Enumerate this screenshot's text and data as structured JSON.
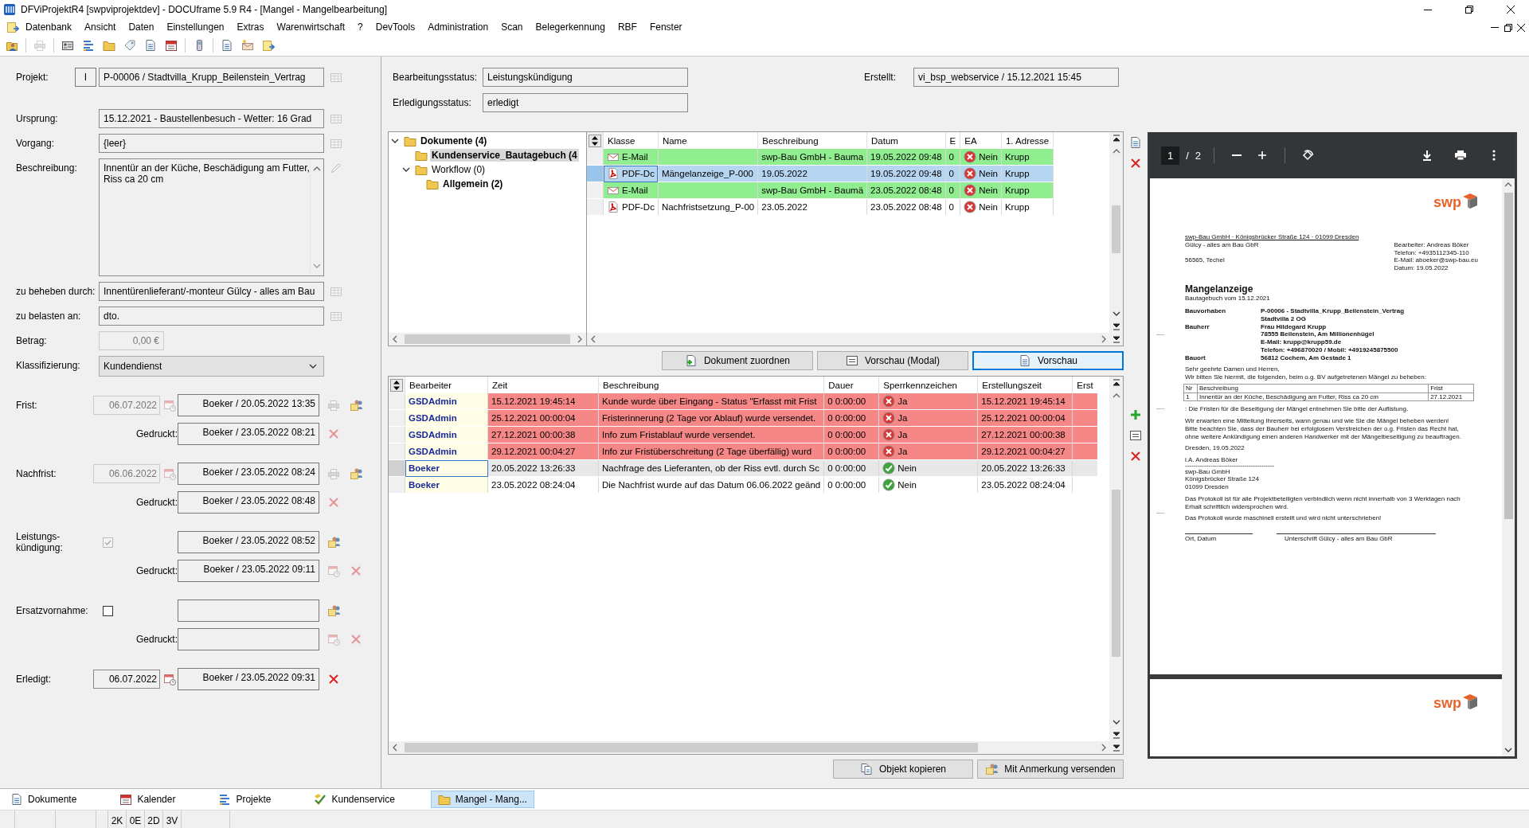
{
  "window": {
    "title": "DFViProjektR4 [swpviprojektdev] - DOCUframe 5.9 R4 - [Mangel - Mangelbearbeitung]"
  },
  "menu": [
    "Datenbank",
    "Ansicht",
    "Daten",
    "Einstellungen",
    "Extras",
    "Warenwirtschaft",
    "?",
    "DevTools",
    "Administration",
    "Scan",
    "Belegerkennung",
    "RBF",
    "Fenster"
  ],
  "form": [
    {
      "kind": "lookup",
      "label": "Projekt:",
      "button": "I",
      "value": "P-00006 / Stadtvilla_Krupp_Beilenstein_Vertrag"
    },
    {
      "kind": "lookup",
      "label": "Ursprung:",
      "value": "15.12.2021 - Baustellenbesuch - Wetter: 16 Grad"
    },
    {
      "kind": "lookup",
      "label": "Vorgang:",
      "value": "{leer}"
    },
    {
      "kind": "memo",
      "label": "Beschreibung:",
      "value": "Innentür an der Küche, Beschädigung am Futter, Riss ca 20 cm"
    },
    {
      "kind": "lookup",
      "label": "zu beheben durch:",
      "value": "Innentürenlieferant/-monteur Gülcy - alles am Bau"
    },
    {
      "kind": "lookup",
      "label": "zu belasten an:",
      "value": "dto."
    },
    {
      "kind": "amount",
      "label": "Betrag:",
      "value": "0,00 €",
      "disabled": true
    },
    {
      "kind": "dropdown",
      "label": "Klassifizierung:",
      "value": "Kundendienst"
    }
  ],
  "deadlines": [
    {
      "kind": "date",
      "label": "Frist:",
      "date": "06.07.2022",
      "date_disabled": true,
      "entry": "Boeker / 20.05.2022 13:35",
      "printed_label": "Gedruckt:",
      "printed": "Boeker / 23.05.2022 08:21"
    },
    {
      "kind": "date",
      "label": "Nachfrist:",
      "date": "06.06.2022",
      "date_disabled": true,
      "entry": "Boeker / 23.05.2022 08:24",
      "printed_label": "Gedruckt:",
      "printed": "Boeker / 23.05.2022 08:48"
    },
    {
      "kind": "check",
      "label": "Leistungs-\nkündigung:",
      "checked": true,
      "disabled": true,
      "entry": "Boeker / 23.05.2022 08:52",
      "printed_label": "Gedruckt:",
      "printed": "Boeker / 23.05.2022 09:11"
    },
    {
      "kind": "check",
      "label": "Ersatzvornahme:",
      "checked": false,
      "disabled": false,
      "printed_label": "Gedruckt:"
    },
    {
      "kind": "date",
      "label": "Erledigt:",
      "date": "06.07.2022",
      "date_disabled": false,
      "entry": "Boeker / 23.05.2022 09:31"
    }
  ],
  "status": {
    "fields": [
      {
        "label": "Bearbeitungsstatus:",
        "value": "Leistungskündigung"
      },
      {
        "label": "Erledigungsstatus:",
        "value": "erledigt"
      }
    ],
    "created": {
      "label": "Erstellt:",
      "value": "vi_bsp_webservice / 15.12.2021 15:45"
    }
  },
  "tree": [
    {
      "label": "Dokumente (4)",
      "bold": true,
      "expanded": true,
      "selected": false,
      "children": [
        {
          "label": "Kundenservice_Bautagebuch (4",
          "bold": true,
          "selected": true
        },
        {
          "label": "Workflow (0)",
          "bold": false,
          "expanded": true,
          "selected": false,
          "children": [
            {
              "label": "Allgemein (2)",
              "bold": true,
              "selected": false
            }
          ]
        }
      ]
    }
  ],
  "documents": {
    "columns": [
      "Klasse",
      "Name",
      "Beschreibung",
      "Datum",
      "E",
      "EA",
      "1. Adresse"
    ],
    "rows": [
      {
        "kind": "email",
        "klasse": "E-Mail",
        "beschreibung": "swp-Bau GmbH - Bauma",
        "datum": "19.05.2022 09:48",
        "e": "0",
        "ea": "Nein",
        "ea_ok": false,
        "adresse": "Krupp",
        "color": "#90ee90",
        "selected": false
      },
      {
        "kind": "pdf",
        "klasse": "PDF-Dc",
        "name": "Mängelanzeige_P-000",
        "beschreibung": "19.05.2022",
        "datum": "19.05.2022 09:48",
        "e": "0",
        "ea": "Nein",
        "ea_ok": false,
        "adresse": "Krupp",
        "color": "#b5d5f1",
        "selected": true
      },
      {
        "kind": "email",
        "klasse": "E-Mail",
        "beschreibung": "swp-Bau GmbH - Baumä",
        "datum": "23.05.2022 08:48",
        "e": "0",
        "ea": "Nein",
        "ea_ok": false,
        "adresse": "Krupp",
        "color": "#90ee90",
        "selected": false
      },
      {
        "kind": "pdf",
        "klasse": "PDF-Dc",
        "name": "Nachfristsetzung_P-00",
        "beschreibung": "23.05.2022",
        "datum": "23.05.2022 08:48",
        "e": "0",
        "ea": "Nein",
        "ea_ok": false,
        "adresse": "Krupp",
        "color": "#ffffff",
        "selected": false
      }
    ]
  },
  "doc_buttons": [
    {
      "label": "Dokument zuordnen",
      "selected": false
    },
    {
      "label": "Vorschau (Modal)",
      "selected": false
    },
    {
      "label": "Vorschau",
      "selected": true
    }
  ],
  "history": {
    "columns": [
      "Bearbeiter",
      "Zeit",
      "Beschreibung",
      "Dauer",
      "Sperrkennzeichen",
      "Erstellungszeit",
      "Erst"
    ],
    "rows": [
      {
        "bearbeiter": "GSDAdmin",
        "zeit": "15.12.2021 19:45:14",
        "beschreibung": "Kunde wurde über Eingang - Status \"Erfasst mit Frist",
        "dauer": "0 0:00:00",
        "sperre": "Ja",
        "sperre_ok": false,
        "erstellt": "15.12.2021 19:45:14",
        "color": "#f58787",
        "selected": false
      },
      {
        "bearbeiter": "GSDAdmin",
        "zeit": "25.12.2021 00:00:04",
        "beschreibung": "Fristerinnerung (2 Tage vor Ablauf) wurde versendet.",
        "dauer": "0 0:00:00",
        "sperre": "Ja",
        "sperre_ok": false,
        "erstellt": "25.12.2021 00:00:04",
        "color": "#f58787",
        "selected": false
      },
      {
        "bearbeiter": "GSDAdmin",
        "zeit": "27.12.2021 00:00:38",
        "beschreibung": "Info zum Fristablauf wurde versendet.",
        "dauer": "0 0:00:00",
        "sperre": "Ja",
        "sperre_ok": false,
        "erstellt": "27.12.2021 00:00:38",
        "color": "#f58787",
        "selected": false
      },
      {
        "bearbeiter": "GSDAdmin",
        "zeit": "29.12.2021 00:04:27",
        "beschreibung": "Info zur Fristüberschreitung (2 Tage überfällig) wurd",
        "dauer": "0 0:00:00",
        "sperre": "Ja",
        "sperre_ok": false,
        "erstellt": "29.12.2021 00:04:27",
        "color": "#f58787",
        "selected": false
      },
      {
        "bearbeiter": "Boeker",
        "zeit": "20.05.2022 13:26:33",
        "beschreibung": "Nachfrage des Lieferanten, ob der Riss evtl. durch Sc",
        "dauer": "0 0:00:00",
        "sperre": "Nein",
        "sperre_ok": true,
        "erstellt": "20.05.2022 13:26:33",
        "color": "#e8e8e8",
        "selected": true
      },
      {
        "bearbeiter": "Boeker",
        "zeit": "23.05.2022 08:24:04",
        "beschreibung": "Die Nachfrist wurde auf das Datum 06.06.2022 geänd",
        "dauer": "0 0:00:00",
        "sperre": "Nein",
        "sperre_ok": true,
        "erstellt": "23.05.2022 08:24:04",
        "color": "#ffffff",
        "selected": false
      }
    ]
  },
  "history_buttons": [
    "Objekt kopieren",
    "Mit Anmerkung versenden"
  ],
  "preview": {
    "page": "1",
    "separator": "/",
    "pages": "2",
    "document": {
      "logo": "swp",
      "sender_line": "swp-Bau GmbH · Königsbrücker Straße 124 · 01099 Dresden",
      "recipient": [
        "Gülcy - alles am Bau GbR",
        "56565, Techel"
      ],
      "contact": [
        "Bearbeiter: Andreas Böker",
        "Telefon: +4935112345-110",
        "E-Mail: aboeker@swp-bau.eu",
        "Datum: 19.05.2022"
      ],
      "title": "Mangelanzeige",
      "subtitle": "Bautagebuch vom 15.12.2021",
      "details": [
        {
          "label": "Bauvorhaben",
          "lines": [
            "P-00006 - Stadtvilla_Krupp_Beilenstein_Vertrag",
            "Stadtvilla 2 OG"
          ]
        },
        {
          "label": "Bauherr",
          "lines": [
            "Frau Hildegard Krupp",
            "78555 Beilenstein, Am Millionenhügel",
            "E-Mail: krupp@krupp59.de",
            "Telefon: +496870020 / Mobil: +4919245875500"
          ]
        },
        {
          "label": "Bauort",
          "lines": [
            "56812 Cochem, Am Gestade 1"
          ]
        }
      ],
      "salutation": "Sehr geehrte Damen und Herren,",
      "intro": "Wir bitten Sie hiermit, die folgenden, beim o.g. BV aufgetretenen Mängel zu beheben:",
      "table": {
        "columns": [
          "Nr",
          "Beschreibung",
          "Frist"
        ],
        "rows": [
          [
            "1",
            "Innentür an der Küche, Beschädigung am Futter, Riss ca 20 cm",
            "27.12.2021"
          ]
        ]
      },
      "note": ": Die Fristen für die Beseitigung der Mängel entnehmen Sie bitte der Auflistung.",
      "paragraph": [
        "Wir erwarten eine Mitteilung Ihrerseits, wann genau und wie Sie die Mängel beheben werden!",
        "Bitte beachten Sie, dass der Bauherr bei erfolglosem Verstreichen der o.g. Fristen das Recht hat,",
        "ohne weitere Ankündigung einen anderen Handwerker mit der Mängelbeseitigung zu beauftragen."
      ],
      "place_date": "Dresden, 19.05.2022",
      "signer": "i.A. Andreas Böker",
      "signer_line": "------------------------------------------",
      "company": [
        "swp-Bau GmbH",
        "Königsbrücker Straße 124",
        "01099 Dresden"
      ],
      "closing": [
        "Das Protokoll ist für alle Projektbeteiligten verbindlich wenn nicht innerhalb von 3 Werktagen nach Erhalt schriftlich widersprochen wird.",
        "Das Protokoll wurde maschinell erstellt und wird nicht unterschrieben!"
      ],
      "signatures": [
        "Ort, Datum",
        "Unterschrift Gülcy - alles am Bau GbR"
      ]
    },
    "page2_logo": "swp"
  },
  "tabs": [
    {
      "label": "Dokumente",
      "selected": false
    },
    {
      "label": "Kalender",
      "selected": false
    },
    {
      "label": "Projekte",
      "selected": false
    },
    {
      "label": "Kundenservice",
      "selected": false
    },
    {
      "label": "Mangel - Mang...",
      "selected": true
    }
  ],
  "status_bar": [
    "2K",
    "0E",
    "2D",
    "3V"
  ]
}
